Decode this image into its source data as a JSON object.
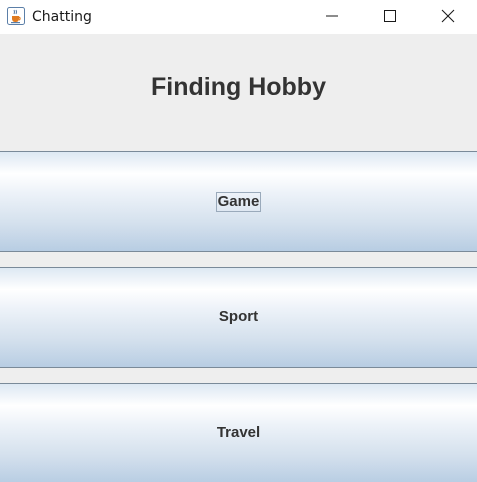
{
  "window": {
    "title": "Chatting",
    "app_icon": "java-cup-icon",
    "controls": [
      "minimize-icon",
      "maximize-icon",
      "close-icon"
    ]
  },
  "header": {
    "title": "Finding Hobby"
  },
  "options": [
    {
      "label": "Game",
      "focused": true
    },
    {
      "label": "Sport",
      "focused": false
    },
    {
      "label": "Travel",
      "focused": false
    }
  ],
  "colors": {
    "background": "#eeeeee",
    "button_gradient_top": "#ffffff",
    "button_gradient_bottom": "#b8cde3",
    "button_border": "#7a8a99",
    "text": "#333333"
  }
}
